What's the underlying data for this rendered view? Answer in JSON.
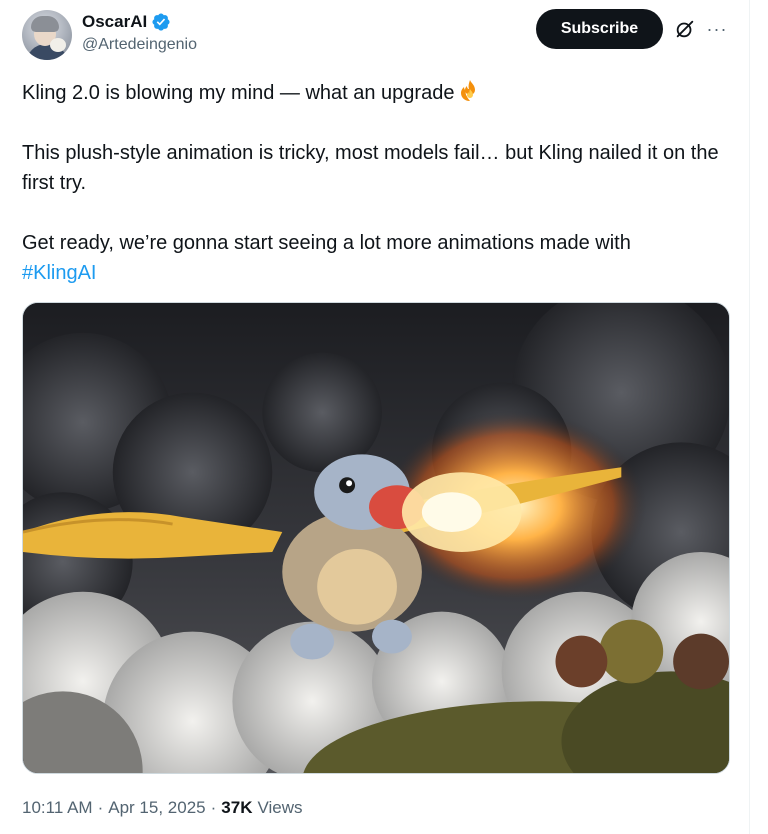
{
  "author": {
    "display_name": "OscarAI",
    "handle": "@Artedeingenio",
    "verified": true
  },
  "actions": {
    "subscribe_label": "Subscribe",
    "grok_icon": "grok-icon",
    "more_icon": "more-icon",
    "more_label": "···"
  },
  "tweet": {
    "line1": "Kling 2.0 is blowing my mind — what an upgrade",
    "line1_emoji": "fire-emoji",
    "line2": "This plush-style animation is tricky, most models fail… but Kling nailed it on the first try.",
    "line3": "Get ready, we’re gonna start seeing a lot more animations made with",
    "hashtag": "#KlingAI"
  },
  "media": {
    "type": "image",
    "description_icon": "plush-dragon-image"
  },
  "meta": {
    "time": "10:11 AM",
    "separator": "·",
    "date": "Apr 15, 2025",
    "views_count": "37K",
    "views_label": "Views"
  },
  "colors": {
    "text": "#0f1419",
    "secondary": "#536471",
    "link": "#1d9bf0",
    "verified": "#1d9bf0",
    "button_bg": "#0f1419"
  }
}
